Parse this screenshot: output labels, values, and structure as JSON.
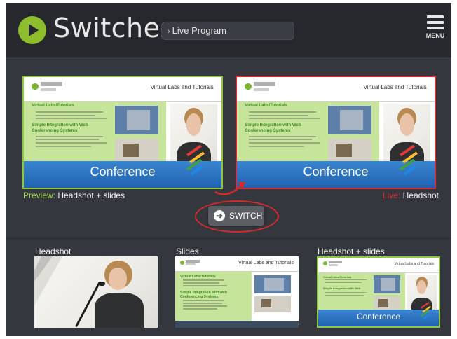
{
  "app": {
    "title": "Switcher"
  },
  "program_select": {
    "chevron": "›",
    "label": "Live Program"
  },
  "menu": {
    "label": "MENU",
    "icon": "hamburger-icon"
  },
  "preview": {
    "key": "Preview:",
    "value": "Headshot + slides"
  },
  "live": {
    "key": "Live:",
    "value": "Headshot"
  },
  "switch_button": {
    "label": "SWITCH",
    "icon": "arrow-right-icon"
  },
  "slide_content": {
    "title": "Virtual Labs and Tutorials",
    "heading1": "Virtual Labs/Tutorials",
    "heading2": "Simple Integration with Web",
    "heading2b": "Conferencing Systems",
    "banner": "Conference"
  },
  "sources": [
    {
      "label": "Headshot"
    },
    {
      "label": "Slides"
    },
    {
      "label": "Headshot + slides"
    }
  ],
  "colors": {
    "preview_accent": "#8dc63f",
    "live_accent": "#d7303a",
    "background": "#34373d",
    "header": "#26282d",
    "logo": "#8ebd2e"
  }
}
